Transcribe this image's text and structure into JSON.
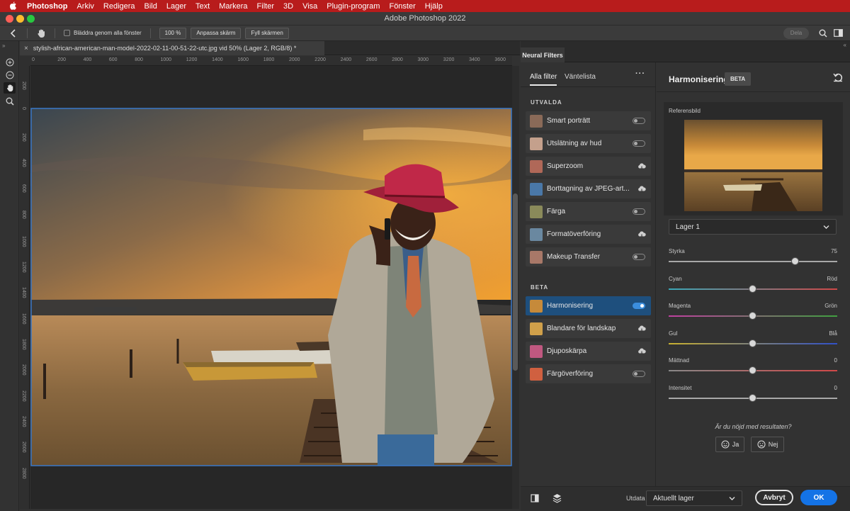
{
  "menubar": {
    "app": "Photoshop",
    "items": [
      "Arkiv",
      "Redigera",
      "Bild",
      "Lager",
      "Text",
      "Markera",
      "Filter",
      "3D",
      "Visa",
      "Plugin-program",
      "Fönster",
      "Hjälp"
    ]
  },
  "window": {
    "title": "Adobe Photoshop 2022"
  },
  "options": {
    "scroll_all_label": "Bläddra genom alla fönster",
    "zoom": "100 %",
    "fit_screen": "Anpassa skärm",
    "fill_screen": "Fyll skärmen",
    "share": "Dela"
  },
  "document": {
    "tab_title": "stylish-african-american-man-model-2022-02-11-00-51-22-utc.jpg vid 50% (Lager 2, RGB/8) *"
  },
  "rulers": {
    "h": [
      "0",
      "200",
      "400",
      "600",
      "800",
      "1000",
      "1200",
      "1400",
      "1600",
      "1800",
      "2000",
      "2200",
      "2400",
      "2600",
      "2800",
      "3000",
      "3200",
      "3400",
      "3600"
    ],
    "v": [
      "200",
      "0",
      "200",
      "400",
      "600",
      "800",
      "1000",
      "1200",
      "1400",
      "1600",
      "1800",
      "2000",
      "2200",
      "2400",
      "2600",
      "2800"
    ]
  },
  "neural": {
    "panel_tab": "Neural Filters",
    "tabs": {
      "all": "Alla filter",
      "waitlist": "Väntelista"
    },
    "more": "···",
    "section_featured": "UTVALDA",
    "section_beta": "BETA",
    "featured": [
      {
        "name": "Smart porträtt",
        "state": "toggle-off",
        "thumb": "#8a6a58"
      },
      {
        "name": "Utslätning av hud",
        "state": "toggle-off",
        "thumb": "#c4a08c"
      },
      {
        "name": "Superzoom",
        "state": "cloud",
        "thumb": "#b06858"
      },
      {
        "name": "Borttagning av JPEG-art...",
        "state": "cloud",
        "thumb": "#4a78a8"
      },
      {
        "name": "Färga",
        "state": "toggle-off",
        "thumb": "#8a8a5a"
      },
      {
        "name": "Formatöverföring",
        "state": "cloud",
        "thumb": "#6a88a0"
      },
      {
        "name": "Makeup Transfer",
        "state": "toggle-off",
        "thumb": "#a87868"
      }
    ],
    "beta": [
      {
        "name": "Harmonisering",
        "state": "toggle-on",
        "thumb": "#c68a3a",
        "selected": true
      },
      {
        "name": "Blandare för landskap",
        "state": "cloud",
        "thumb": "#d0a04a"
      },
      {
        "name": "Djuposkärpa",
        "state": "cloud",
        "thumb": "#c05880"
      },
      {
        "name": "Färgöverföring",
        "state": "toggle-off",
        "thumb": "#d06040"
      }
    ]
  },
  "detail": {
    "title": "Harmonisering",
    "badge": "BETA",
    "ref_label": "Referensbild",
    "layer_select": "Lager 1",
    "sliders": [
      {
        "label": "Styrka",
        "right": "75",
        "value": 75,
        "min": 0,
        "max": 100
      },
      {
        "label": "Cyan",
        "right": "Röd",
        "value": 0,
        "min": -50,
        "max": 50
      },
      {
        "label": "Magenta",
        "right": "Grön",
        "value": 0,
        "min": -50,
        "max": 50
      },
      {
        "label": "Gul",
        "right": "Blå",
        "value": 0,
        "min": -50,
        "max": 50
      },
      {
        "label": "Mättnad",
        "right": "0",
        "value": 0,
        "min": -50,
        "max": 50
      },
      {
        "label": "Intensitet",
        "right": "0",
        "value": 0,
        "min": -50,
        "max": 50
      }
    ],
    "feedback_q": "Är du nöjd med resultaten?",
    "yes": "Ja",
    "no": "Nej"
  },
  "footer": {
    "output_label": "Utdata",
    "output_value": "Aktuellt lager",
    "cancel": "Avbryt",
    "ok": "OK"
  },
  "colors": {
    "accent": "#1473e6",
    "menubar": "#b81c1c",
    "selected": "#1e4f7d"
  }
}
